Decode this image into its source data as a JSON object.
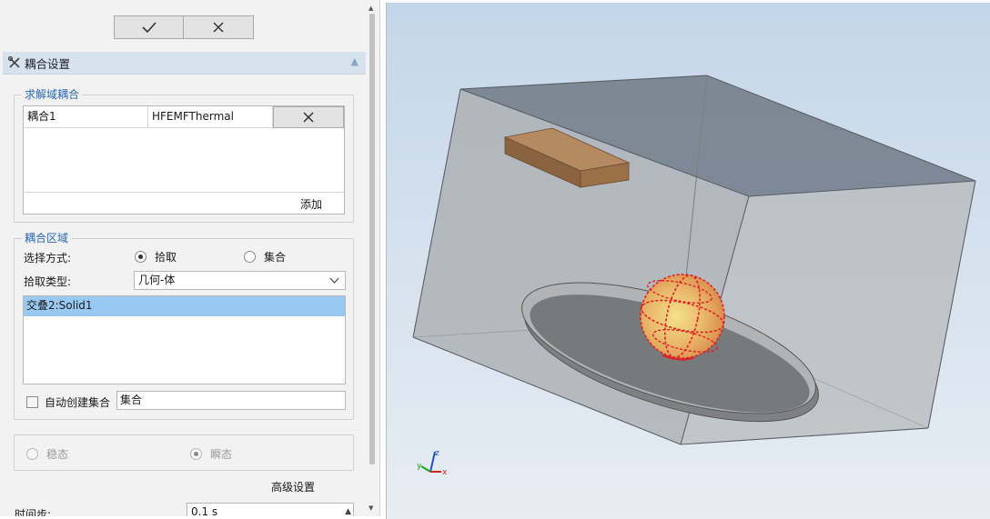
{
  "toolbar": {
    "confirm_icon": "checkmark-icon",
    "cancel_icon": "close-icon"
  },
  "section": {
    "title": "耦合设置",
    "icon": "wrench-icon"
  },
  "solve_coupling": {
    "legend": "求解域耦合",
    "rows": [
      {
        "name": "耦合1",
        "type": "HFEMFThermal"
      }
    ],
    "add_label": "添加"
  },
  "coupling_region": {
    "legend": "耦合区域",
    "select_mode_label": "选择方式:",
    "mode_options": [
      "拾取",
      "集合"
    ],
    "mode_selected": "拾取",
    "pick_type_label": "拾取类型:",
    "pick_type_value": "几何-体",
    "picked_items": [
      "交叠2:Solid1"
    ],
    "auto_create_label": "自动创建集合",
    "auto_create_checked": false,
    "set_name": "集合"
  },
  "analysis_mode": {
    "options": [
      "稳态",
      "瞬态"
    ],
    "selected": "瞬态"
  },
  "advanced_label": "高级设置",
  "time_step_label": "时间步:",
  "time_step_value": "0.1 s",
  "axis_triad": {
    "x": "x",
    "y": "y",
    "z": "z"
  },
  "colors": {
    "accent": "#2a6bb5",
    "selection": "#99c9f2",
    "sphere_highlight": "#e02020"
  }
}
